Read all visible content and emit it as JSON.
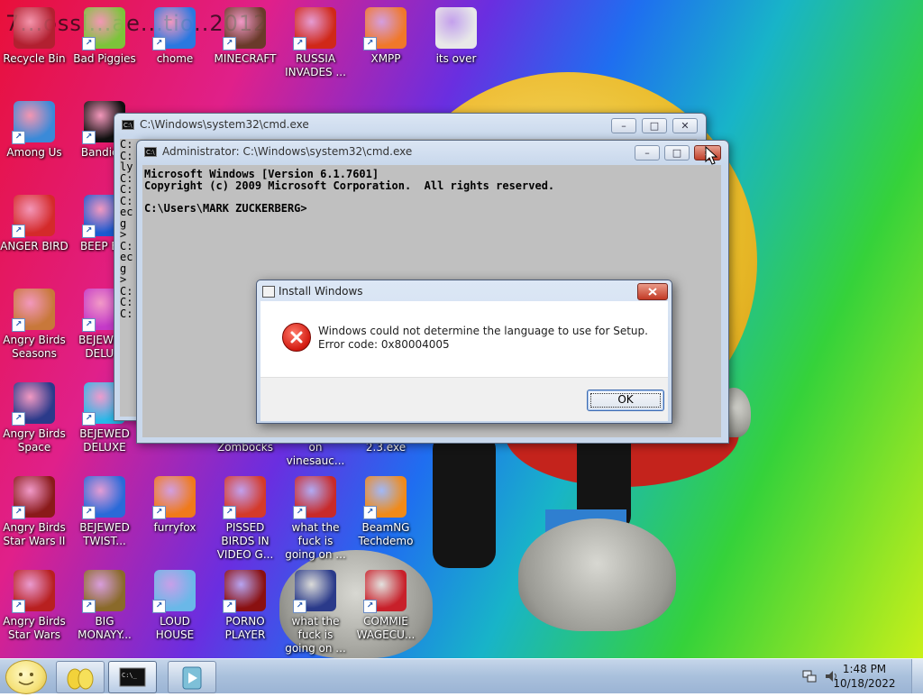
{
  "desktop": {
    "overlay_text": "7...ossl...ae...tio..2012",
    "icons": [
      {
        "label": "Recycle Bin",
        "icon": "recycle-bin-icon",
        "color": "#b22030"
      },
      {
        "label": "Bad Piggies",
        "icon": "bad-piggies-icon",
        "color": "#7cc43a"
      },
      {
        "label": "chome",
        "icon": "chrome-icon",
        "color": "#2a78e0"
      },
      {
        "label": "MINECRAFT",
        "icon": "minecraft-icon",
        "color": "#6a3a2a"
      },
      {
        "label": "RUSSIA INVADES ...",
        "icon": "radiation-icon",
        "color": "#d02818"
      },
      {
        "label": "XMPP",
        "icon": "xampp-icon",
        "color": "#f0782a"
      },
      {
        "label": "its over",
        "icon": "document-icon",
        "color": "#e8e8e8"
      },
      {
        "label": "Among Us",
        "icon": "among-us-icon",
        "color": "#3a8ad8"
      },
      {
        "label": "Bandic...",
        "icon": "bandicam-icon",
        "color": "#101010"
      },
      {
        "label": "ANGER BIRD",
        "icon": "angry-birds-icon",
        "color": "#d42a2a"
      },
      {
        "label": "BEEP B...",
        "icon": "beep-icon",
        "color": "#1a5ad0"
      },
      {
        "label": "Angry Birds Seasons",
        "icon": "angry-birds-seasons-icon",
        "color": "#c8783a"
      },
      {
        "label": "BEJEWE... DELU...",
        "icon": "bejeweled-icon",
        "color": "#c43ac8"
      },
      {
        "label": "Angry Birds Space",
        "icon": "angry-birds-space-icon",
        "color": "#2a3a8a"
      },
      {
        "label": "BEJEWED DELUXE",
        "icon": "bejeweled-deluxe-icon",
        "color": "#28b8e8"
      },
      {
        "label": "Angry Birds Star Wars II",
        "icon": "angry-birds-star-wars-2-icon",
        "color": "#8a1a1a"
      },
      {
        "label": "BEJEWED TWIST...",
        "icon": "bejeweled-twist-icon",
        "color": "#2a6ad8"
      },
      {
        "label": "furryfox",
        "icon": "firefox-icon",
        "color": "#f07a1a"
      },
      {
        "label": "PISSED BIRDS IN VIDEO G...",
        "icon": "angry-birds-go-icon",
        "color": "#d43a2a"
      },
      {
        "label": "what the fuck is going on ...",
        "icon": "angry-birds-icon",
        "color": "#c82a2a"
      },
      {
        "label": "BeamNG Techdemo",
        "icon": "beamng-icon",
        "color": "#f08a1a"
      },
      {
        "label": "Angry Birds Star Wars",
        "icon": "angry-birds-star-wars-icon",
        "color": "#b82020"
      },
      {
        "label": "BIG MONAYY...",
        "icon": "money-bag-icon",
        "color": "#8a6a2a"
      },
      {
        "label": "LOUD HOUSE",
        "icon": "loud-house-icon",
        "color": "#6ab8e8"
      },
      {
        "label": "PORNO PLAYER",
        "icon": "flash-player-icon",
        "color": "#8a1010"
      },
      {
        "label": "what the fuck is going on ...",
        "icon": "angry-birds-space-icon",
        "color": "#2a3a8a"
      },
      {
        "label": "COMMIE WAGECU...",
        "icon": "commie-icon",
        "color": "#c8202a"
      }
    ],
    "partial_labels": [
      "Zombocks",
      "on vinesauc...",
      "2.3.exe"
    ]
  },
  "windows": {
    "back_cmd": {
      "title": "C:\\Windows\\system32\\cmd.exe",
      "visible_lines": "C:\nC:\nly\nC:\nC:\nC:\nec\ng\n>\nC:\nec\ng\n>\nC:\nC:\nC:"
    },
    "front_cmd": {
      "title": "Administrator: C:\\Windows\\system32\\cmd.exe",
      "text": "Microsoft Windows [Version 6.1.7601]\nCopyright (c) 2009 Microsoft Corporation.  All rights reserved.\n\nC:\\Users\\MARK ZUCKERBERG>"
    }
  },
  "dialog": {
    "title": "Install Windows",
    "message": "Windows could not determine the language to use for Setup. Error code: 0x80004005",
    "ok_label": "OK"
  },
  "taskbar": {
    "time": "1:48 PM",
    "date": "10/18/2022"
  }
}
